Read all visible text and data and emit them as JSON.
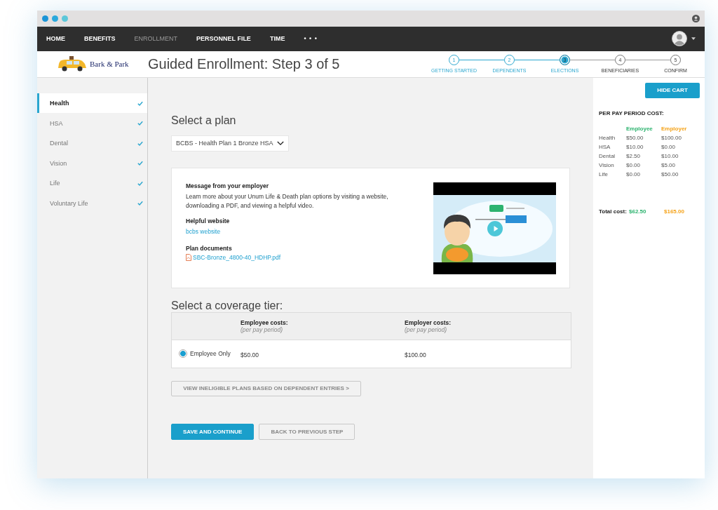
{
  "nav": {
    "items": [
      {
        "label": "HOME",
        "selected": false
      },
      {
        "label": "BENEFITS",
        "selected": false
      },
      {
        "label": "ENROLLMENT",
        "selected": true
      },
      {
        "label": "PERSONNEL FILE",
        "selected": false
      },
      {
        "label": "TIME",
        "selected": false
      }
    ],
    "more": "• • •"
  },
  "header": {
    "logo": "Bark & Park",
    "title": "Guided Enrollment: Step 3 of 5",
    "steps": [
      {
        "number": "1",
        "label": "GETTING STARTED",
        "completed": true,
        "current": false
      },
      {
        "number": "2",
        "label": "DEPENDENTS",
        "completed": true,
        "current": false
      },
      {
        "number": "3",
        "label": "ELECTIONS",
        "completed": false,
        "current": true
      },
      {
        "number": "4",
        "label": "BENEFICIARIES",
        "completed": false,
        "current": false
      },
      {
        "number": "5",
        "label": "CONFIRM",
        "completed": false,
        "current": false
      }
    ]
  },
  "sidebar": {
    "items": [
      {
        "label": "Health",
        "selected": true,
        "checked": true
      },
      {
        "label": "HSA",
        "selected": false,
        "checked": true
      },
      {
        "label": "Dental",
        "selected": false,
        "checked": true
      },
      {
        "label": "Vision",
        "selected": false,
        "checked": true
      },
      {
        "label": "Life",
        "selected": false,
        "checked": true
      },
      {
        "label": "Voluntary Life",
        "selected": false,
        "checked": true
      }
    ]
  },
  "plan": {
    "heading": "Select a plan",
    "dropdown": "BCBS - Health Plan 1 Bronze HSA",
    "message_title": "Message from your employer",
    "message": "Learn more about your Unum Life & Death plan options by visiting a website, downloading a PDF, and viewing a helpful video.",
    "website_title": "Helpful website",
    "website_link": "bcbs website",
    "documents_title": "Plan documents",
    "document_link": "SBC-Bronze_4800-40_HDHP.pdf"
  },
  "coverage": {
    "heading": "Select a coverage tier:",
    "columns": [
      {
        "title": "Employee costs:",
        "subtitle": "(per pay period)"
      },
      {
        "title": "Employer costs:",
        "subtitle": "(per pay period)"
      }
    ],
    "rows": [
      {
        "label": "Employee Only",
        "selected": true,
        "employee": "$50.00",
        "employer": "$100.00"
      }
    ]
  },
  "ineligible_button": "VIEW INELIGIBLE PLANS BASED ON DEPENDENT ENTRIES >",
  "buttons": [
    {
      "label": "SAVE AND CONTINUE",
      "kind": "primary"
    },
    {
      "label": "BACK TO PREVIOUS STEP",
      "kind": "secondary"
    }
  ],
  "cart": {
    "button": "HIDE CART",
    "heading": "PER PAY PERIOD COST:",
    "columns": [
      {
        "label": "Employee",
        "color": "#2db36f"
      },
      {
        "label": "Employer",
        "color": "#f5a31a"
      }
    ],
    "rows": [
      {
        "label": "Health",
        "values": [
          "$50.00",
          "$100.00"
        ]
      },
      {
        "label": "HSA",
        "values": [
          "$10.00",
          "$0.00"
        ]
      },
      {
        "label": "Dental",
        "values": [
          "$2.50",
          "$10.00"
        ]
      },
      {
        "label": "Vision",
        "values": [
          "$0.00",
          "$5.00"
        ]
      },
      {
        "label": "Life",
        "values": [
          "$0.00",
          "$50.00"
        ]
      }
    ],
    "total_label": "Total cost:",
    "totals": [
      "$62.50",
      "$165.00"
    ]
  }
}
